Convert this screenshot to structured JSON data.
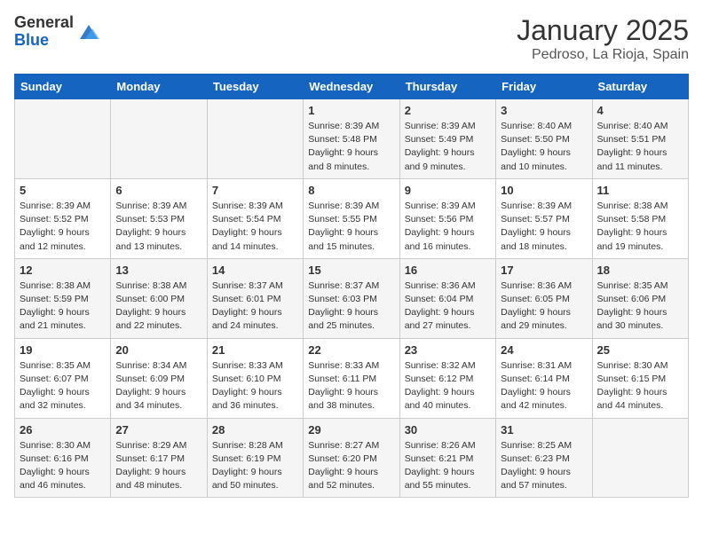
{
  "header": {
    "logo_general": "General",
    "logo_blue": "Blue",
    "month": "January 2025",
    "location": "Pedroso, La Rioja, Spain"
  },
  "days_of_week": [
    "Sunday",
    "Monday",
    "Tuesday",
    "Wednesday",
    "Thursday",
    "Friday",
    "Saturday"
  ],
  "weeks": [
    [
      {
        "day": "",
        "info": ""
      },
      {
        "day": "",
        "info": ""
      },
      {
        "day": "",
        "info": ""
      },
      {
        "day": "1",
        "info": "Sunrise: 8:39 AM\nSunset: 5:48 PM\nDaylight: 9 hours and 8 minutes."
      },
      {
        "day": "2",
        "info": "Sunrise: 8:39 AM\nSunset: 5:49 PM\nDaylight: 9 hours and 9 minutes."
      },
      {
        "day": "3",
        "info": "Sunrise: 8:40 AM\nSunset: 5:50 PM\nDaylight: 9 hours and 10 minutes."
      },
      {
        "day": "4",
        "info": "Sunrise: 8:40 AM\nSunset: 5:51 PM\nDaylight: 9 hours and 11 minutes."
      }
    ],
    [
      {
        "day": "5",
        "info": "Sunrise: 8:39 AM\nSunset: 5:52 PM\nDaylight: 9 hours and 12 minutes."
      },
      {
        "day": "6",
        "info": "Sunrise: 8:39 AM\nSunset: 5:53 PM\nDaylight: 9 hours and 13 minutes."
      },
      {
        "day": "7",
        "info": "Sunrise: 8:39 AM\nSunset: 5:54 PM\nDaylight: 9 hours and 14 minutes."
      },
      {
        "day": "8",
        "info": "Sunrise: 8:39 AM\nSunset: 5:55 PM\nDaylight: 9 hours and 15 minutes."
      },
      {
        "day": "9",
        "info": "Sunrise: 8:39 AM\nSunset: 5:56 PM\nDaylight: 9 hours and 16 minutes."
      },
      {
        "day": "10",
        "info": "Sunrise: 8:39 AM\nSunset: 5:57 PM\nDaylight: 9 hours and 18 minutes."
      },
      {
        "day": "11",
        "info": "Sunrise: 8:38 AM\nSunset: 5:58 PM\nDaylight: 9 hours and 19 minutes."
      }
    ],
    [
      {
        "day": "12",
        "info": "Sunrise: 8:38 AM\nSunset: 5:59 PM\nDaylight: 9 hours and 21 minutes."
      },
      {
        "day": "13",
        "info": "Sunrise: 8:38 AM\nSunset: 6:00 PM\nDaylight: 9 hours and 22 minutes."
      },
      {
        "day": "14",
        "info": "Sunrise: 8:37 AM\nSunset: 6:01 PM\nDaylight: 9 hours and 24 minutes."
      },
      {
        "day": "15",
        "info": "Sunrise: 8:37 AM\nSunset: 6:03 PM\nDaylight: 9 hours and 25 minutes."
      },
      {
        "day": "16",
        "info": "Sunrise: 8:36 AM\nSunset: 6:04 PM\nDaylight: 9 hours and 27 minutes."
      },
      {
        "day": "17",
        "info": "Sunrise: 8:36 AM\nSunset: 6:05 PM\nDaylight: 9 hours and 29 minutes."
      },
      {
        "day": "18",
        "info": "Sunrise: 8:35 AM\nSunset: 6:06 PM\nDaylight: 9 hours and 30 minutes."
      }
    ],
    [
      {
        "day": "19",
        "info": "Sunrise: 8:35 AM\nSunset: 6:07 PM\nDaylight: 9 hours and 32 minutes."
      },
      {
        "day": "20",
        "info": "Sunrise: 8:34 AM\nSunset: 6:09 PM\nDaylight: 9 hours and 34 minutes."
      },
      {
        "day": "21",
        "info": "Sunrise: 8:33 AM\nSunset: 6:10 PM\nDaylight: 9 hours and 36 minutes."
      },
      {
        "day": "22",
        "info": "Sunrise: 8:33 AM\nSunset: 6:11 PM\nDaylight: 9 hours and 38 minutes."
      },
      {
        "day": "23",
        "info": "Sunrise: 8:32 AM\nSunset: 6:12 PM\nDaylight: 9 hours and 40 minutes."
      },
      {
        "day": "24",
        "info": "Sunrise: 8:31 AM\nSunset: 6:14 PM\nDaylight: 9 hours and 42 minutes."
      },
      {
        "day": "25",
        "info": "Sunrise: 8:30 AM\nSunset: 6:15 PM\nDaylight: 9 hours and 44 minutes."
      }
    ],
    [
      {
        "day": "26",
        "info": "Sunrise: 8:30 AM\nSunset: 6:16 PM\nDaylight: 9 hours and 46 minutes."
      },
      {
        "day": "27",
        "info": "Sunrise: 8:29 AM\nSunset: 6:17 PM\nDaylight: 9 hours and 48 minutes."
      },
      {
        "day": "28",
        "info": "Sunrise: 8:28 AM\nSunset: 6:19 PM\nDaylight: 9 hours and 50 minutes."
      },
      {
        "day": "29",
        "info": "Sunrise: 8:27 AM\nSunset: 6:20 PM\nDaylight: 9 hours and 52 minutes."
      },
      {
        "day": "30",
        "info": "Sunrise: 8:26 AM\nSunset: 6:21 PM\nDaylight: 9 hours and 55 minutes."
      },
      {
        "day": "31",
        "info": "Sunrise: 8:25 AM\nSunset: 6:23 PM\nDaylight: 9 hours and 57 minutes."
      },
      {
        "day": "",
        "info": ""
      }
    ]
  ]
}
